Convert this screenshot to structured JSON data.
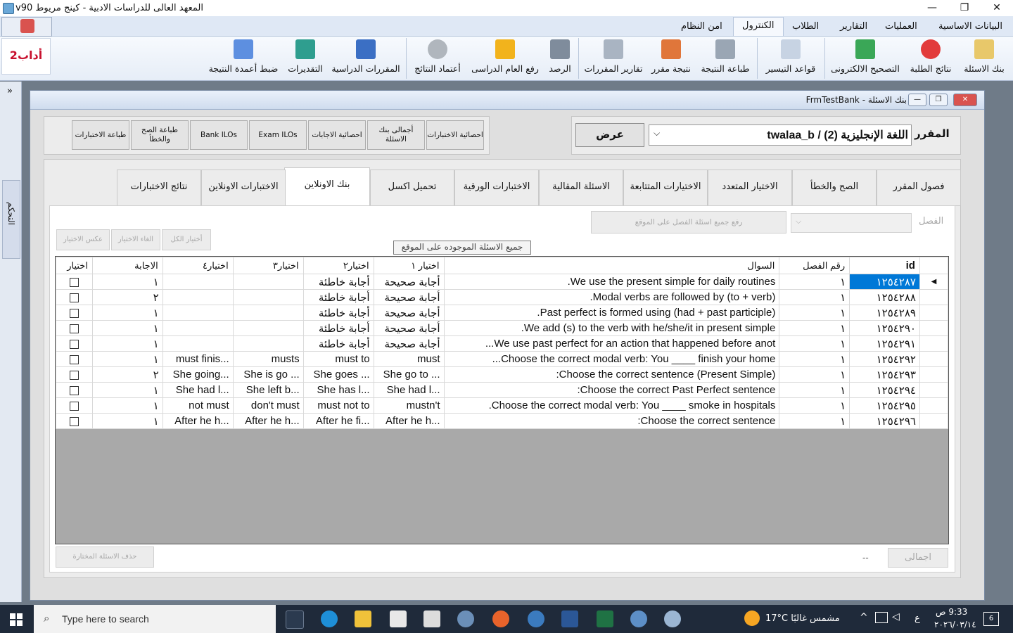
{
  "window": {
    "title": "المعهد العالى للدراسات الادبية - كينج مريوط v90",
    "minimize": "—",
    "maximize": "❐",
    "close": "✕"
  },
  "menu": {
    "tabs": [
      "البيانات الاساسية",
      "العمليات",
      "التقارير",
      "الطلاب",
      "الكنترول",
      "امن النظام"
    ],
    "active": "الكنترول"
  },
  "ribbon": {
    "items": [
      {
        "label": "بنك الاسئلة",
        "color": "#e8c86a"
      },
      {
        "label": "نتائج الطلبة",
        "color": "#e23b3b"
      },
      {
        "label": "التصحيح الالكترونى",
        "color": "#3aa757"
      },
      {
        "label": "قواعد التيسير",
        "color": "#c7d3e3"
      },
      {
        "label": "طباعة النتيجة",
        "color": "#9aa6b4"
      },
      {
        "label": "نتيجة مقرر",
        "color": "#e0763a"
      },
      {
        "label": "تقارير المقررات",
        "color": "#a9b4c2"
      },
      {
        "label": "الرصد",
        "color": "#7f8c9c"
      },
      {
        "label": "رفع العام الدراسى",
        "color": "#f2b31c"
      },
      {
        "label": "أعتماد النتائج",
        "color": "#b0b6bd"
      },
      {
        "label": "المقررات الدراسية",
        "color": "#3b6fc4"
      },
      {
        "label": "التقديرات",
        "color": "#2f9e8f"
      },
      {
        "label": "ضبط أعمدة النتيجة",
        "color": "#5d8fe0"
      }
    ]
  },
  "side": {
    "badge": "أداب2",
    "collapse": "»",
    "vertical_tab": "التحكم"
  },
  "form": {
    "title": "FrmTestBank - بنك الاسئلة",
    "course_label": "المقرر",
    "course_value": "اللغة الإنجليزية (2) / twalaa_b",
    "show_button": "عرض",
    "small_buttons": [
      "احصائية الاختبارات",
      "أجمالى بنك الاسئلة",
      "احصائية الاجابات",
      "Exam ILOs",
      "Bank ILOs",
      "طباعة الصح والخطأ",
      "طباعة الاختبارات"
    ],
    "tabs": [
      "فصول المقرر",
      "الصح والخطأ",
      "الاختيار المتعدد",
      "الاختيارات المتتابعة",
      "الاسئلة المقالية",
      "الاختبارات الورقية",
      "تحميل اكسل",
      "بنك الاونلاين",
      "الاختبارات الاونلاين",
      "نتائج الاختبارات"
    ],
    "active_tab": "بنك الاونلاين",
    "chapter_label": "الفصل",
    "upload_button": "رفع جميع اسئلة الفصل على الموقع",
    "select_all": "أختيار الكل",
    "cancel_select": "الغاء الاختيار",
    "invert_select": "عكس الاختيار",
    "all_on_site": "جميع الاسئلة الموجوده على الموقع",
    "delete_selected": "حذف الاسئلة المختارة",
    "total_label": "اجمالى",
    "total_value": "--"
  },
  "grid": {
    "columns": [
      "id",
      "رقم الفصل",
      "السوال",
      "اختيار ١",
      "اختيار٢",
      "اختيار٣",
      "اختيار٤",
      "الاجابة",
      "اختيار"
    ],
    "rows": [
      {
        "id": "١٢٥٤٢٨٧",
        "ch": "١",
        "q": "We use the present simple for daily routines.",
        "a1": "أجابة صحيحة",
        "a2": "أجابة خاطئة",
        "a3": "",
        "a4": "",
        "ans": "١"
      },
      {
        "id": "١٢٥٤٢٨٨",
        "ch": "١",
        "q": "Modal verbs are followed by (to + verb).",
        "a1": "أجابة صحيحة",
        "a2": "أجابة خاطئة",
        "a3": "",
        "a4": "",
        "ans": "٢"
      },
      {
        "id": "١٢٥٤٢٨٩",
        "ch": "١",
        "q": "Past perfect is formed using (had + past participle).",
        "a1": "أجابة صحيحة",
        "a2": "أجابة خاطئة",
        "a3": "",
        "a4": "",
        "ans": "١"
      },
      {
        "id": "١٢٥٤٢٩٠",
        "ch": "١",
        "q": "We add (s) to the verb with he/she/it in present simple.",
        "a1": "أجابة صحيحة",
        "a2": "أجابة خاطئة",
        "a3": "",
        "a4": "",
        "ans": "١"
      },
      {
        "id": "١٢٥٤٢٩١",
        "ch": "١",
        "q": "We use past perfect for an action that happened before anot...",
        "a1": "أجابة صحيحة",
        "a2": "أجابة خاطئة",
        "a3": "",
        "a4": "",
        "ans": "١"
      },
      {
        "id": "١٢٥٤٢٩٢",
        "ch": "١",
        "q": "Choose the correct modal verb: You ____ finish your home...",
        "a1": "must",
        "a2": "must to",
        "a3": "musts",
        "a4": "must finis...",
        "ans": "١"
      },
      {
        "id": "١٢٥٤٢٩٣",
        "ch": "١",
        "q": "Choose the correct sentence (Present Simple):",
        "a1": "She go to ...",
        "a2": "She goes ...",
        "a3": "She is go ...",
        "a4": "She going...",
        "ans": "٢"
      },
      {
        "id": "١٢٥٤٢٩٤",
        "ch": "١",
        "q": "Choose the correct Past Perfect sentence:",
        "a1": "She had l...",
        "a2": "She has l...",
        "a3": "She left b...",
        "a4": "She had l...",
        "ans": "١"
      },
      {
        "id": "١٢٥٤٢٩٥",
        "ch": "١",
        "q": "Choose the correct modal verb: You ____ smoke in hospitals.",
        "a1": "mustn't",
        "a2": "must not to",
        "a3": "don't must",
        "a4": "not must",
        "ans": "١"
      },
      {
        "id": "١٢٥٤٢٩٦",
        "ch": "١",
        "q": "Choose the correct sentence:",
        "a1": "After he h...",
        "a2": "After he fi...",
        "a3": "After he h...",
        "a4": "After he h...",
        "ans": "١"
      }
    ]
  },
  "taskbar": {
    "search_placeholder": "Type here to search",
    "weather": "17°C  مشمس غالبًا",
    "lang": "ع",
    "time": "9:33 ص",
    "date": "٢٠٢٦/٠٣/١٤",
    "notif": "6"
  }
}
